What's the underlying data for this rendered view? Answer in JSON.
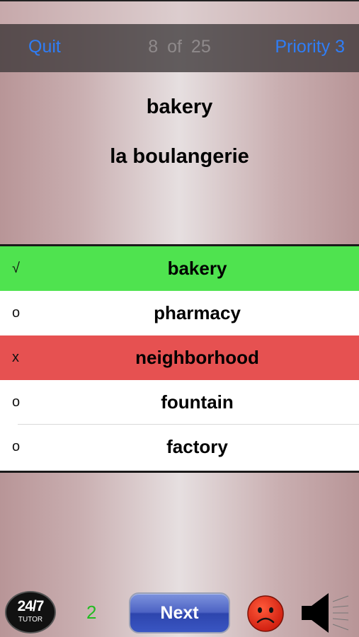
{
  "nav": {
    "quit_label": "Quit",
    "counter": "8 of 25",
    "priority_label": "Priority 3",
    "link_color": "#2f7df6"
  },
  "prompt": {
    "word": "bakery",
    "translation": "la boulangerie"
  },
  "choices": [
    {
      "mark": "√",
      "text": "bakery",
      "state": "correct"
    },
    {
      "mark": "o",
      "text": "pharmacy",
      "state": "neutral"
    },
    {
      "mark": "x",
      "text": "neighborhood",
      "state": "wrong"
    },
    {
      "mark": "o",
      "text": "fountain",
      "state": "neutral"
    },
    {
      "mark": "o",
      "text": "factory",
      "state": "neutral"
    }
  ],
  "status_colors": {
    "correct": "#4fe34f",
    "wrong": "#e65151"
  },
  "toolbar": {
    "logo_big": "24/7",
    "logo_small": "TUTOR",
    "score": "2",
    "next_label": "Next",
    "feedback_icon": "sad-face-icon",
    "sound_icon": "speaker-icon"
  }
}
